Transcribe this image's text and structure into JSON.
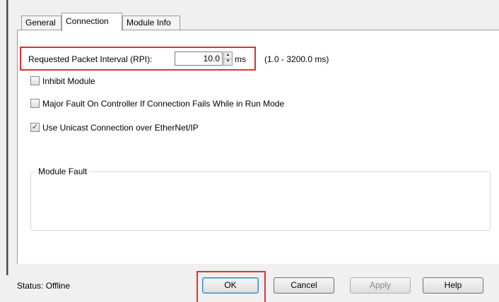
{
  "tabs": [
    {
      "label": "General",
      "active": false
    },
    {
      "label": "Connection",
      "active": true
    },
    {
      "label": "Module Info",
      "active": false
    }
  ],
  "rpi": {
    "label": "Requested Packet Interval (RPI):",
    "value": "10.0",
    "unit": "ms",
    "range": "(1.0 - 3200.0 ms)"
  },
  "options": {
    "inhibit": {
      "label": "Inhibit Module",
      "checked": false
    },
    "major_fault": {
      "label": "Major Fault On Controller If Connection Fails While in Run Mode",
      "checked": false
    },
    "unicast": {
      "label": "Use Unicast Connection over EtherNet/IP",
      "checked": true
    }
  },
  "module_fault": {
    "legend": "Module Fault"
  },
  "status": {
    "text": "Status:  Offline"
  },
  "buttons": {
    "ok": "OK",
    "cancel": "Cancel",
    "apply": "Apply",
    "help": "Help"
  },
  "colors": {
    "highlight": "#e23030",
    "check": "#1e3f8a"
  },
  "icons": {
    "spin_up": "▲",
    "spin_down": "▼",
    "check": "✓"
  }
}
